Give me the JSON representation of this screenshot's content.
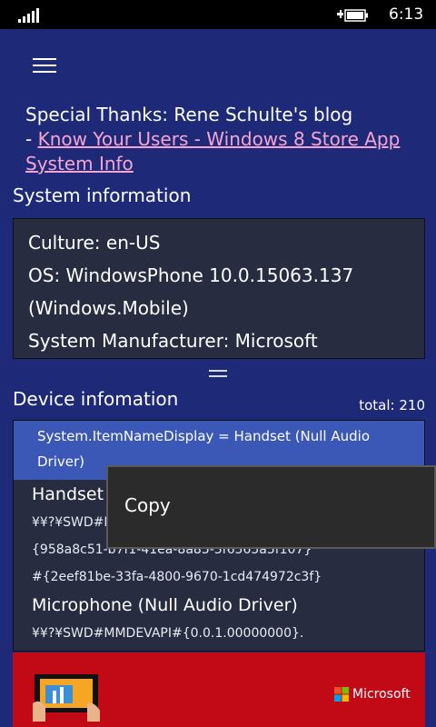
{
  "status_bar": {
    "time": "6:13"
  },
  "thanks": {
    "prefix": "Special Thanks: Rene Schulte's blog",
    "dash": "- ",
    "link": "Know Your Users - Windows 8 Store App System Info"
  },
  "system_info": {
    "title": "System information",
    "lines": [
      "Culture: en-US",
      "OS: WindowsPhone 10.0.15063.137",
      "(Windows.Mobile)",
      "System Manufacturer: Microsoft"
    ]
  },
  "device_info": {
    "title": "Device infomation",
    "total": "total: 210",
    "selected": "System.ItemNameDisplay = Handset (Null Audio Driver)",
    "items": [
      {
        "name": "Handset (Null Audio Driver)",
        "id_lines": [
          "¥¥?¥SWD#MMDEVAPI#{0.0.1.00000000}.",
          "{958a8c51-b7f1-41ea-8a85-3f6565a5f107}",
          "#{2eef81be-33fa-4800-9670-1cd474972c3f}"
        ]
      },
      {
        "name": "Microphone (Null Audio Driver)",
        "id_lines": [
          "¥¥?¥SWD#MMDEVAPI#{0.0.1.00000000}."
        ]
      }
    ]
  },
  "context_menu": {
    "copy": "Copy"
  },
  "ad": {
    "brand": "Microsoft"
  },
  "colors": {
    "background": "#1e2a78",
    "panel": "#272c41",
    "selection": "#3b58b7",
    "link": "#f6a5d2",
    "ad": "#c20a17"
  },
  "icons": [
    "signal-strength-icon",
    "battery-icon",
    "hamburger-menu-icon",
    "microsoft-logo-icon"
  ]
}
